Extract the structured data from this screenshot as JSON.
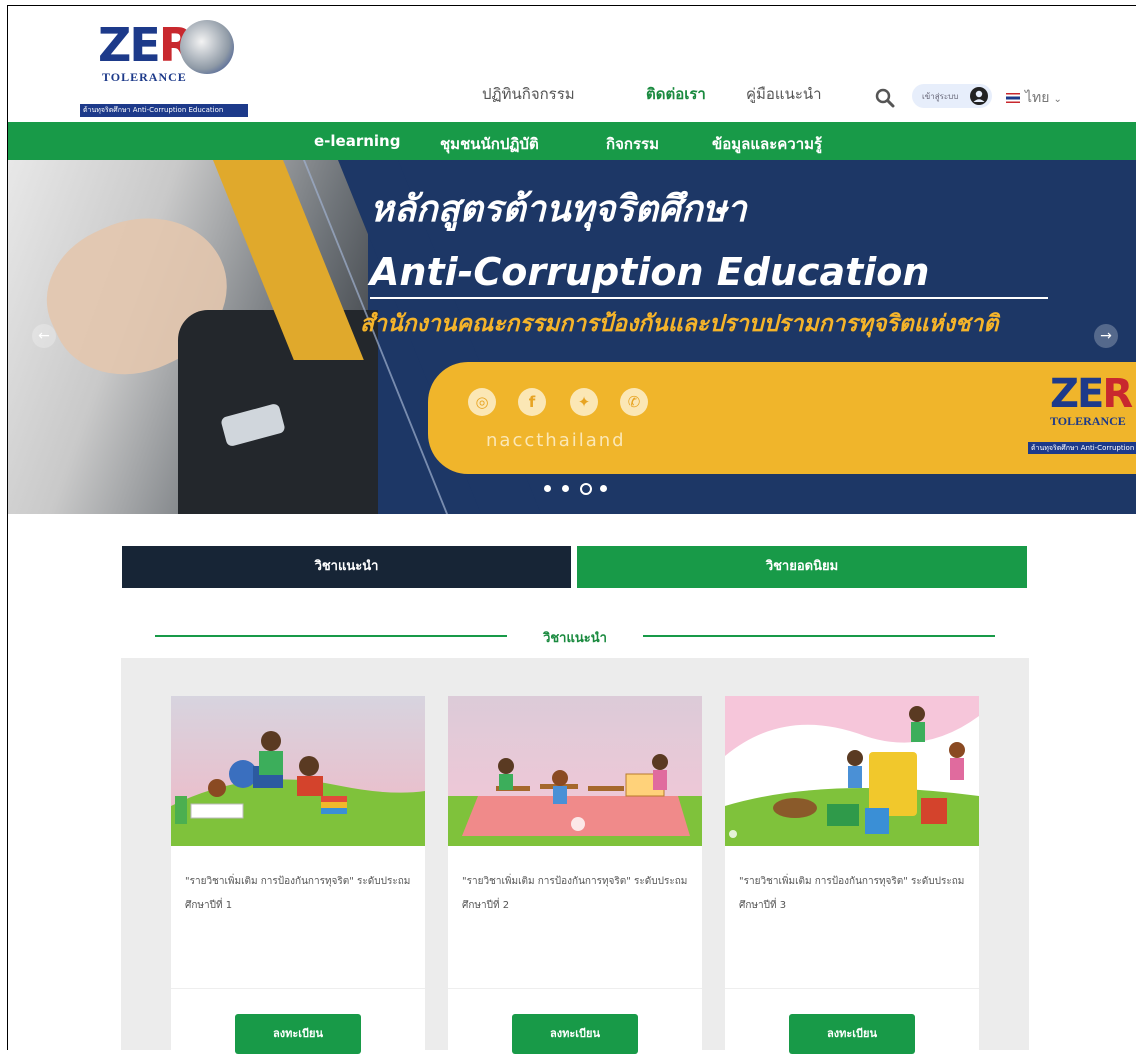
{
  "logo": {
    "wordmark": "ZERO",
    "subtitle": "TOLERANCE",
    "band_text": "ต้านทุจริตศึกษา Anti-Corruption Education"
  },
  "topnav": {
    "item1": "ปฏิทินกิจกรรม",
    "item2": "ติดต่อเรา",
    "item3": "คู่มือแนะนำ",
    "login_label": "เข้าสู่ระบบ",
    "language": "ไทย"
  },
  "greennav": {
    "items": [
      "e-learning",
      "ชุมชนนักปฏิบัติ",
      "กิจกรรม",
      "ข้อมูลและความรู้"
    ]
  },
  "hero": {
    "title_th": "หลักสูตรต้านทุจริตศึกษา",
    "title_en": "Anti-Corruption Education",
    "subtitle_th": "สำนักงานคณะกรรมการป้องกันและปราบปรามการทุจริตแห่งชาติ",
    "social_handle": "naccthailand",
    "prev_arrow": "←",
    "next_arrow": "→",
    "slide_count": 4,
    "active_slide": 3,
    "icons": [
      "instagram-icon",
      "facebook-icon",
      "twitter-icon",
      "whatsapp-icon"
    ]
  },
  "tabs": {
    "recommended": "วิชาแนะนำ",
    "popular": "วิชายอดนิยม"
  },
  "section_title": "วิชาแนะนำ",
  "cards": [
    {
      "desc": "\"รายวิชาเพิ่มเติม การป้องกันการทุจริต\" ระดับประถมศึกษาปีที่ 1",
      "button": "ลงทะเบียน"
    },
    {
      "desc": "\"รายวิชาเพิ่มเติม การป้องกันการทุจริต\" ระดับประถมศึกษาปีที่ 2",
      "button": "ลงทะเบียน"
    },
    {
      "desc": "\"รายวิชาเพิ่มเติม การป้องกันการทุจริต\" ระดับประถมศึกษาปีที่ 3",
      "button": "ลงทะเบียน"
    }
  ],
  "colors": {
    "brand_green": "#189a48",
    "dark_tab": "#172536",
    "hero_blue": "#1d3766",
    "hero_gold": "#f0b52b"
  }
}
